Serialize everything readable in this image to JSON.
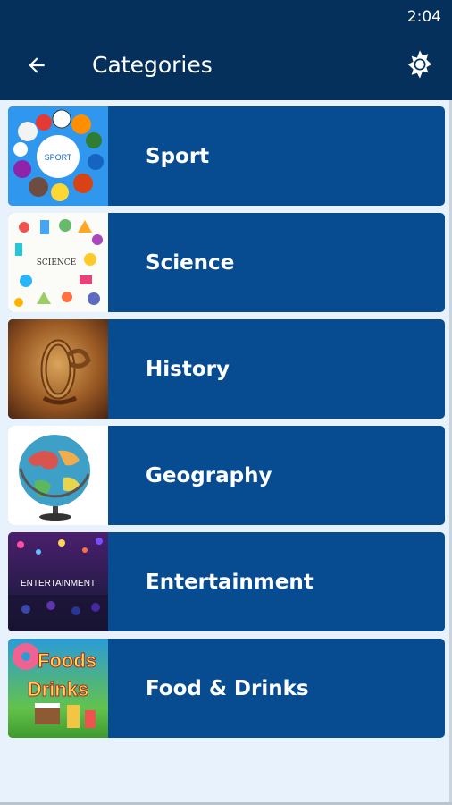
{
  "status_bar": {
    "time": "2:04"
  },
  "app_bar": {
    "title": "Categories",
    "back_icon": "arrow-left-icon",
    "theme_icon": "brightness-icon"
  },
  "colors": {
    "app_bar": "#05305c",
    "card": "#074b91",
    "background": "#e8f2fc"
  },
  "categories": [
    {
      "label": "Sport",
      "thumb_text": "SPORT"
    },
    {
      "label": "Science",
      "thumb_text": "SCIENCE"
    },
    {
      "label": "History"
    },
    {
      "label": "Geography"
    },
    {
      "label": "Entertainment",
      "thumb_text": "ENTERTAINMENT"
    },
    {
      "label": "Food & Drinks",
      "thumb_text_1": "Foods",
      "thumb_text_2": "Drinks"
    }
  ]
}
